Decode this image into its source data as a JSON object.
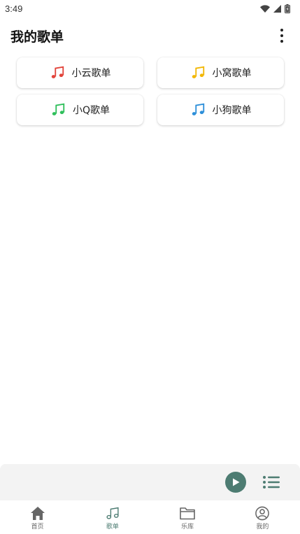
{
  "status_bar": {
    "time": "3:49"
  },
  "header": {
    "title": "我的歌单"
  },
  "playlists": [
    {
      "label": "小云歌单",
      "icon": "music-note-icon",
      "color": "#e2443b"
    },
    {
      "label": "小窝歌单",
      "icon": "music-note-icon",
      "color": "#f2b705"
    },
    {
      "label": "小Q歌单",
      "icon": "music-note-icon",
      "color": "#2fbf5b"
    },
    {
      "label": "小狗歌单",
      "icon": "music-note-icon",
      "color": "#2d8fd9"
    }
  ],
  "player": {
    "accent": "#4d7c72",
    "play_icon": "play-icon",
    "queue_icon": "list-icon"
  },
  "nav": {
    "items": [
      {
        "label": "首页",
        "icon": "home-icon"
      },
      {
        "label": "歌单",
        "icon": "music-note-icon",
        "active": true
      },
      {
        "label": "乐库",
        "icon": "folder-icon"
      },
      {
        "label": "我的",
        "icon": "user-circle-icon"
      }
    ],
    "active_color": "#4d7c72",
    "inactive_color": "#666666"
  }
}
